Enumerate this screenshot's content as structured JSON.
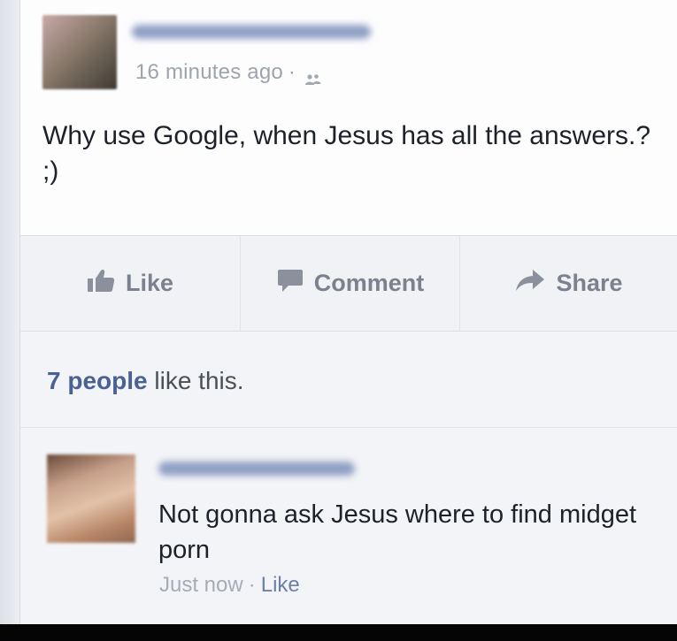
{
  "post": {
    "author_name": "",
    "timestamp": "16 minutes ago",
    "separator": "·",
    "audience_icon": "friends-icon",
    "text": "Why use Google, when Jesus has all the answers.? ;)"
  },
  "actions": {
    "like_label": "Like",
    "comment_label": "Comment",
    "share_label": "Share"
  },
  "likes": {
    "count_text": "7 people",
    "suffix_text": " like this."
  },
  "comment": {
    "author_name": "",
    "text": "Not gonna ask Jesus where to find midget porn",
    "timestamp": "Just now",
    "separator": "·",
    "like_label": "Like"
  },
  "colors": {
    "link_blue": "#4a6194",
    "muted_gray": "#9ea4ae",
    "action_gray": "#7b818e",
    "text_dark": "#1d2129"
  }
}
